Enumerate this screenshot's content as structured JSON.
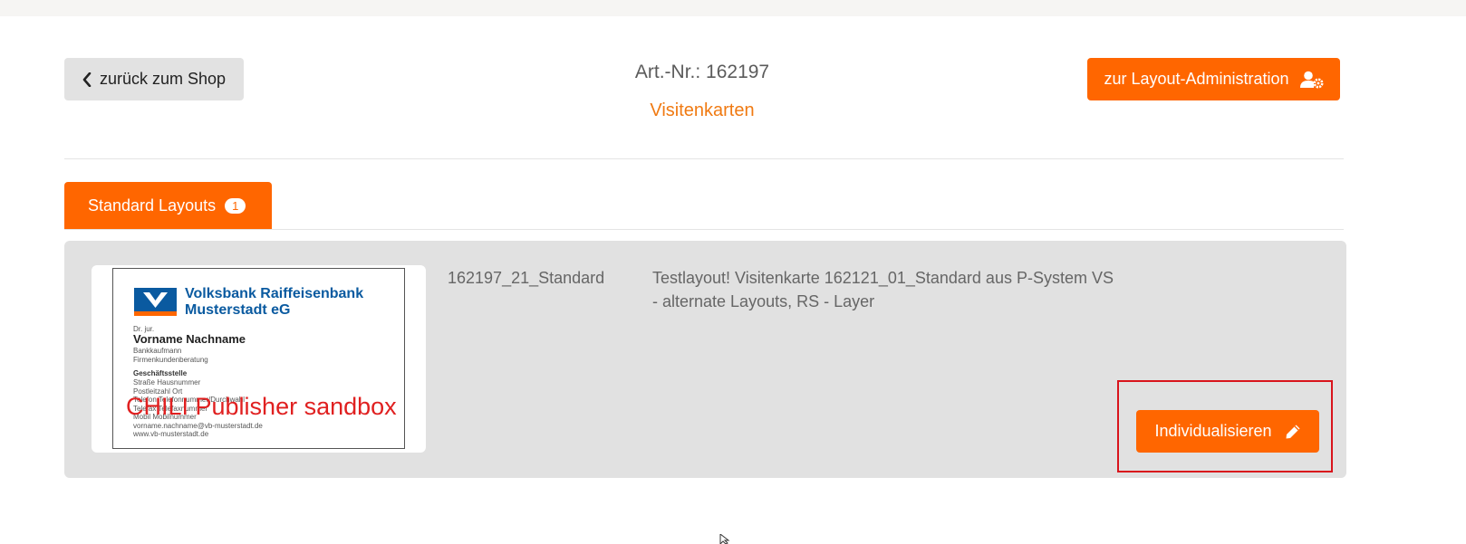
{
  "header": {
    "back_label": "zurück zum Shop",
    "article_number": "Art.-Nr.: 162197",
    "category": "Visitenkarten",
    "admin_label": "zur Layout-Administration"
  },
  "tabs": [
    {
      "label": "Standard Layouts",
      "count": "1"
    }
  ],
  "layout": {
    "id": "162197_21_Standard",
    "description_line1": "Testlayout! Visitenkarte 162121_01_Standard aus P-System VS",
    "description_line2": "- alternate Layouts, RS - Layer",
    "action_label": "Individualisieren"
  },
  "preview": {
    "bank_line1": "Volksbank Raiffeisenbank",
    "bank_line2": "Musterstadt eG",
    "title": "Dr. jur.",
    "name": "Vorname Nachname",
    "job1": "Bankkaufmann",
    "job2": "Firmenkundenberatung",
    "dept": "Geschäftsstelle",
    "addr1": "Straße Hausnummer",
    "addr2": "Postleitzahl Ort",
    "tel": "Telefon  Telefonnummer/Durchwahl",
    "fax": "Telefax  Telefaxnummer",
    "mobile": "Mobil    Mobilnummer",
    "email": "vorname.nachname@vb-musterstadt.de",
    "web": "www.vb-musterstadt.de",
    "watermark": "CHILI Publisher sandbox"
  },
  "colors": {
    "accent": "#ff6600",
    "category_text": "#f07a12",
    "highlight_border": "#d9141c",
    "panel_bg": "#e1e1e1",
    "bank_blue": "#0a5aa0"
  }
}
